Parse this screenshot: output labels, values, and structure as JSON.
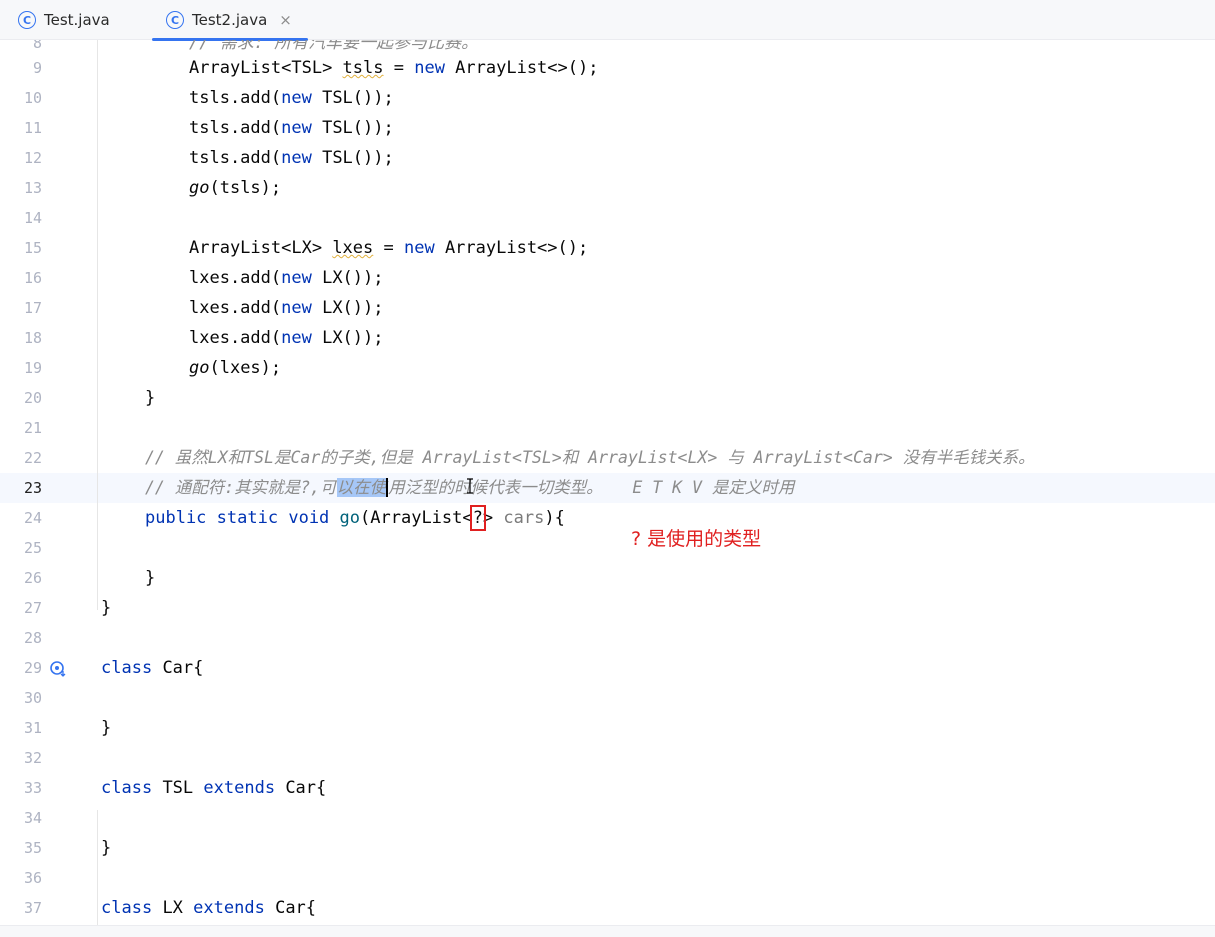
{
  "tabs": [
    {
      "label": "Test.java",
      "icon": "java-class-icon"
    },
    {
      "label": "Test2.java",
      "icon": "java-class-icon",
      "close": "×"
    }
  ],
  "lines": {
    "l8": {
      "num": "8",
      "text": "// 需求: 所有汽车要一起参与比赛。"
    },
    "l9": {
      "num": "9"
    },
    "l10": {
      "num": "10"
    },
    "l11": {
      "num": "11"
    },
    "l12": {
      "num": "12"
    },
    "l13": {
      "num": "13"
    },
    "l14": {
      "num": "14"
    },
    "l15": {
      "num": "15"
    },
    "l16": {
      "num": "16"
    },
    "l17": {
      "num": "17"
    },
    "l18": {
      "num": "18"
    },
    "l19": {
      "num": "19"
    },
    "l20": {
      "num": "20"
    },
    "l21": {
      "num": "21"
    },
    "l22": {
      "num": "22",
      "comment": "// 虽然LX和TSL是Car的子类,但是 ArrayList<TSL>和 ArrayList<LX> 与 ArrayList<Car> 没有半毛钱关系。"
    },
    "l23": {
      "num": "23",
      "c_pre": "// 通配符:其实就是?,可",
      "c_sel": "以在使",
      "c_post": "用泛型的时候代表一切类型。   E T K V 是定义时用"
    },
    "l24": {
      "num": "24"
    },
    "l25": {
      "num": "25"
    },
    "l26": {
      "num": "26"
    },
    "l27": {
      "num": "27"
    },
    "l28": {
      "num": "28"
    },
    "l29": {
      "num": "29"
    },
    "l30": {
      "num": "30"
    },
    "l31": {
      "num": "31"
    },
    "l32": {
      "num": "32"
    },
    "l33": {
      "num": "33"
    },
    "l34": {
      "num": "34"
    },
    "l35": {
      "num": "35"
    },
    "l36": {
      "num": "36"
    },
    "l37": {
      "num": "37"
    }
  },
  "tokens": {
    "arraylist": "ArrayList",
    "tsl_generic": "<TSL> ",
    "lx_generic": "<LX> ",
    "tsls": "tsls",
    "lxes": "lxes",
    "assign": " = ",
    "new": "new",
    "diamond_end": " ArrayList<>();",
    "tsls_add": "tsls.add(",
    "lxes_add": "lxes.add(",
    "tsl_ctor_end": " TSL());",
    "lx_ctor_end": " LX());",
    "go": "go",
    "go_tsls_args": "(tsls);",
    "go_lxes_args": "(lxes);",
    "close_brace": "}",
    "public": "public",
    "static": "static",
    "void": "void",
    "go_decl_open": "(ArrayList<",
    "wildcard": "?",
    "go_decl_gt": ">",
    "cars": "cars",
    "go_decl_end": "){",
    "class": "class",
    "extends": "extends",
    "car_open": "Car{",
    "tsl": "TSL",
    "lx": "LX"
  },
  "annotation": "? 是使用的类型",
  "gutter": {
    "line29_icon": "implemented-by-icon"
  },
  "colors": {
    "keyword": "#0033b3",
    "comment": "#8c8c8c",
    "annotation": "#e02020",
    "accent": "#3574f0",
    "selection": "#a6c7f7"
  }
}
